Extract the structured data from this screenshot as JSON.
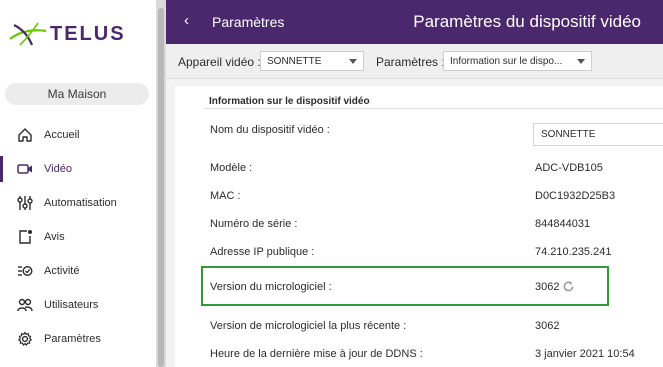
{
  "brand": {
    "name": "TELUS",
    "accent": "#4b286d"
  },
  "sidebar": {
    "home_label": "Ma Maison",
    "items": [
      {
        "label": "Accueil",
        "icon": "home-icon",
        "active": false
      },
      {
        "label": "Vidéo",
        "icon": "video-camera-icon",
        "active": true
      },
      {
        "label": "Automatisation",
        "icon": "sliders-icon",
        "active": false
      },
      {
        "label": "Avis",
        "icon": "notification-icon",
        "active": false
      },
      {
        "label": "Activité",
        "icon": "activity-list-icon",
        "active": false
      },
      {
        "label": "Utilisateurs",
        "icon": "users-icon",
        "active": false
      },
      {
        "label": "Paramètres",
        "icon": "gear-icon",
        "active": false
      }
    ]
  },
  "header": {
    "back_glyph": "‹",
    "breadcrumb": "Paramètres",
    "title": "Paramètres du dispositif vidéo"
  },
  "toolbar": {
    "device_label": "Appareil vidéo :",
    "device_value": "SONNETTE",
    "settings_label": "Paramètres :",
    "settings_value": "Information sur le dispo..."
  },
  "panel": {
    "title": "Information sur le dispositif vidéo",
    "rows": [
      {
        "label": "Nom du dispositif vidéo :",
        "value": "SONNETTE"
      },
      {
        "label": "Modèle :",
        "value": "ADC-VDB105"
      },
      {
        "label": "MAC :",
        "value": "D0C1932D25B3"
      },
      {
        "label": "Numéro de série :",
        "value": "844844031"
      },
      {
        "label": "Adresse IP publique :",
        "value": "74.210.235.241"
      },
      {
        "label": "Version du micrologiciel :",
        "value": "3062"
      },
      {
        "label": "Version de micrologiciel la plus récente :",
        "value": "3062"
      },
      {
        "label": "Heure de la dernière mise à jour de DDNS :",
        "value": "3 janvier 2021 10:54"
      }
    ]
  },
  "colors": {
    "header_bg": "#4b286d",
    "highlight_border": "#2e9c39",
    "logo_green": "#66cc00"
  }
}
